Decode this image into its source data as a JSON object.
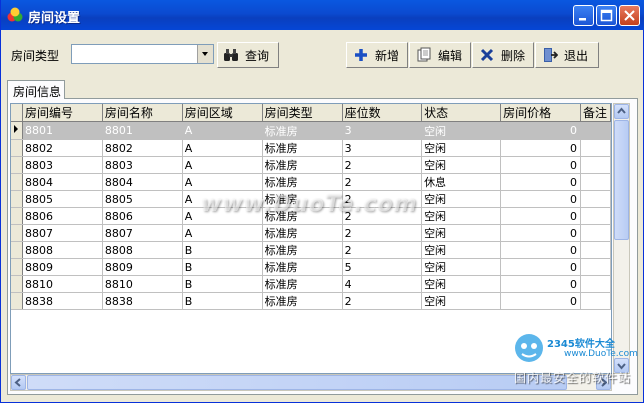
{
  "window": {
    "title": "房间设置"
  },
  "filter": {
    "label": "房间类型",
    "value": "",
    "search_label": "查询"
  },
  "toolbar": {
    "add_label": "新增",
    "edit_label": "编辑",
    "delete_label": "删除",
    "exit_label": "退出"
  },
  "tabs": [
    {
      "label": "房间信息"
    }
  ],
  "grid": {
    "columns": [
      "房间编号",
      "房间名称",
      "房间区域",
      "房间类型",
      "座位数",
      "状态",
      "房间价格",
      "备注"
    ],
    "rows": [
      [
        "8801",
        "8801",
        "A",
        "标准房",
        "3",
        "空闲",
        "0",
        ""
      ],
      [
        "8802",
        "8802",
        "A",
        "标准房",
        "3",
        "空闲",
        "0",
        ""
      ],
      [
        "8803",
        "8803",
        "A",
        "标准房",
        "2",
        "空闲",
        "0",
        ""
      ],
      [
        "8804",
        "8804",
        "A",
        "标准房",
        "2",
        "休息",
        "0",
        ""
      ],
      [
        "8805",
        "8805",
        "A",
        "标准房",
        "2",
        "空闲",
        "0",
        ""
      ],
      [
        "8806",
        "8806",
        "A",
        "标准房",
        "2",
        "空闲",
        "0",
        ""
      ],
      [
        "8807",
        "8807",
        "A",
        "标准房",
        "2",
        "空闲",
        "0",
        ""
      ],
      [
        "8808",
        "8808",
        "B",
        "标准房",
        "2",
        "空闲",
        "0",
        ""
      ],
      [
        "8809",
        "8809",
        "B",
        "标准房",
        "5",
        "空闲",
        "0",
        ""
      ],
      [
        "8810",
        "8810",
        "B",
        "标准房",
        "4",
        "空闲",
        "0",
        ""
      ],
      [
        "8838",
        "8838",
        "B",
        "标准房",
        "2",
        "空闲",
        "0",
        ""
      ]
    ],
    "selected_row": 0
  },
  "watermark": {
    "main": "www.DuoTe.com",
    "brand": "2345软件大全",
    "url": "www.DuoTe.com",
    "slogan": "国内最安全的软件站"
  },
  "colors": {
    "titlebar": "#0a4fd6",
    "selected_row": "#c0c0c0",
    "face": "#ece9d8"
  }
}
